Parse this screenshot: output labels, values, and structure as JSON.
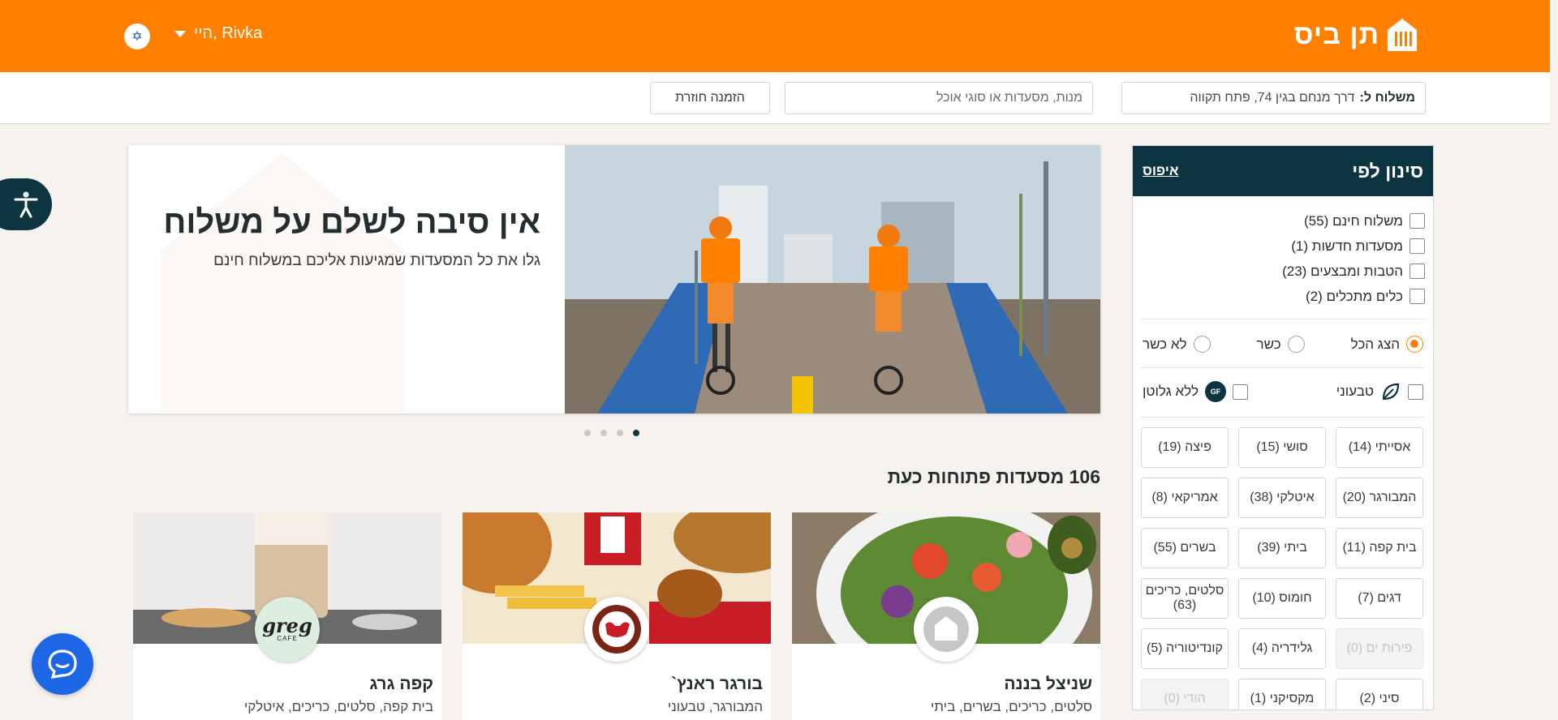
{
  "header": {
    "logo_text": "תן ביס",
    "greeting": "היי, Rivka",
    "flag_icon": "israel-flag-icon",
    "brand_color": "#ff8000"
  },
  "subheader": {
    "address_prefix": "משלוח ל:",
    "address_value": "דרך מנחם בגין 74, פתח תקווה",
    "search_placeholder": "מנות, מסעדות או סוגי אוכל",
    "reorder_label": "הזמנה חוזרת"
  },
  "banner": {
    "title": "אין סיבה לשלם על משלוח",
    "subtitle": "גלו את כל המסעדות שמגיעות אליכם במשלוח חינם",
    "slides": 4,
    "active_slide": 1
  },
  "restaurants": {
    "count_title": "106 מסעדות פתוחות כעת",
    "cards": [
      {
        "name": "שניצל בננה",
        "tags": "סלטים, כריכים, בשרים, ביתי"
      },
      {
        "name": "בורגר ראנץ`",
        "tags": "המבורגר, טבעוני"
      },
      {
        "name": "קפה גרג",
        "tags": "בית קפה, סלטים, כריכים, איטלקי",
        "logo_text": "greg",
        "logo_sub": "CAFE"
      }
    ]
  },
  "filters": {
    "title": "סינון לפי",
    "reset_label": "איפוס",
    "checkboxes": [
      "משלוח חינם (55)",
      "מסעדות חדשות (1)",
      "הטבות ומבצעים (23)",
      "כלים מתכלים (2)"
    ],
    "kosher": [
      "הצג הכל",
      "כשר",
      "לא כשר"
    ],
    "kosher_selected": "הצג הכל",
    "diet": {
      "vegan": "טבעוני",
      "gluten_free": "ללא גלוטן",
      "gf_badge": "GF"
    },
    "cuisines": [
      {
        "label": "אסייתי (14)",
        "disabled": false
      },
      {
        "label": "סושי (15)",
        "disabled": false
      },
      {
        "label": "פיצה (19)",
        "disabled": false
      },
      {
        "label": "המבורגר (20)",
        "disabled": false
      },
      {
        "label": "איטלקי (38)",
        "disabled": false
      },
      {
        "label": "אמריקאי (8)",
        "disabled": false
      },
      {
        "label": "בית קפה (11)",
        "disabled": false
      },
      {
        "label": "ביתי (39)",
        "disabled": false
      },
      {
        "label": "בשרים (55)",
        "disabled": false
      },
      {
        "label": "דגים (7)",
        "disabled": false
      },
      {
        "label": "חומוס (10)",
        "disabled": false
      },
      {
        "label": "סלטים, כריכים (63)",
        "disabled": false
      },
      {
        "label": "פירות ים (0)",
        "disabled": true
      },
      {
        "label": "גלידריה (4)",
        "disabled": false
      },
      {
        "label": "קונדיטוריה (5)",
        "disabled": false
      },
      {
        "label": "סיני (2)",
        "disabled": false
      },
      {
        "label": "מקסיקני (1)",
        "disabled": false
      },
      {
        "label": "הודי (0)",
        "disabled": true
      }
    ]
  }
}
